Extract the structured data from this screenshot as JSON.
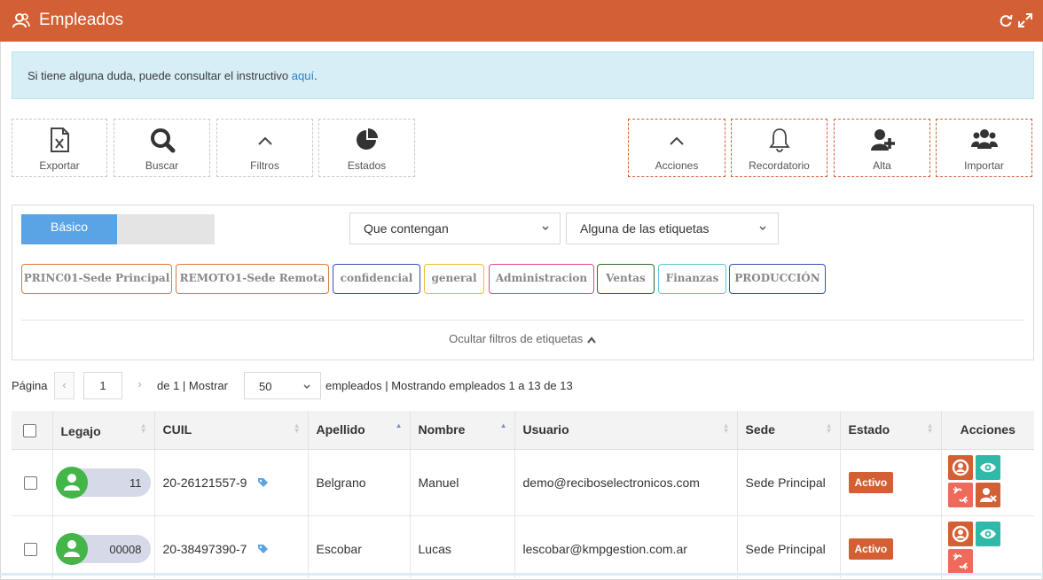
{
  "window": {
    "title": "Empleados",
    "accent_color": "#d35f34",
    "title_icon": "users-icon"
  },
  "alert": {
    "text": "Si tiene alguna duda, puede consultar el instructivo ",
    "link": "aquí",
    "suffix": "."
  },
  "toolbar_left": [
    {
      "label": "Exportar",
      "icon": "excel-file-icon"
    },
    {
      "label": "Buscar",
      "icon": "search-icon"
    },
    {
      "label": "Filtros",
      "icon": "chevron-up-icon"
    },
    {
      "label": "Estados",
      "icon": "pie-chart-icon"
    }
  ],
  "toolbar_right": [
    {
      "label": "Acciones",
      "icon": "chevron-up-icon"
    },
    {
      "label": "Recordatorio",
      "icon": "bell-icon"
    },
    {
      "label": "Alta",
      "icon": "add-user-icon"
    },
    {
      "label": "Importar",
      "icon": "group-icon"
    }
  ],
  "filters": {
    "mode_active": "Básico",
    "match_select": "Que contengan",
    "tags_select": "Alguna de las etiquetas",
    "tags": [
      {
        "label": "PRINC01-Sede Principal",
        "color": "#e07b3a"
      },
      {
        "label": "REMOTO1-Sede Remota",
        "color": "#e07b3a"
      },
      {
        "label": "confidencial",
        "color": "#3a4fb8"
      },
      {
        "label": "general",
        "color": "#e8c02a"
      },
      {
        "label": "Administracion",
        "color": "#e04a8a"
      },
      {
        "label": "Ventas",
        "color": "#2d6b2d"
      },
      {
        "label": "Finanzas",
        "color": "#5ac8d8"
      },
      {
        "label": "PRODUCCIÓN",
        "color": "#3a4fb8"
      }
    ],
    "hide_label": "Ocultar filtros de etiquetas"
  },
  "pager": {
    "page_label": "Página",
    "page_value": "1",
    "of_text": "de 1 | Mostrar",
    "page_size": "50",
    "summary": "empleados | Mostrando empleados 1 a 13 de 13"
  },
  "table": {
    "headers": [
      "Legajo",
      "CUIL",
      "Apellido",
      "Nombre",
      "Usuario",
      "Sede",
      "Estado",
      "Acciones"
    ],
    "rows": [
      {
        "legajo": "11",
        "cuil": "20-26121557-9",
        "apellido": "Belgrano",
        "nombre": "Manuel",
        "usuario": "demo@reciboselectronicos.com",
        "sede": "Sede Principal",
        "estado": "Activo"
      },
      {
        "legajo": "00008",
        "cuil": "20-38497390-7",
        "apellido": "Escobar",
        "nombre": "Lucas",
        "usuario": "lescobar@kmpgestion.com.ar",
        "sede": "Sede Principal",
        "estado": "Activo"
      }
    ]
  }
}
